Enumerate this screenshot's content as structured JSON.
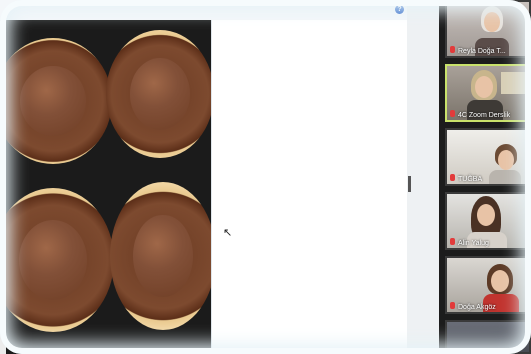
{
  "app": {
    "window": "zoom-meeting-screen-share"
  },
  "share": {
    "help_icon": "?",
    "cursor_icon": "arrow-cursor"
  },
  "participants": [
    {
      "name": "Reyla Doğa T...",
      "active": false
    },
    {
      "name": "4C Zoom Derslik",
      "active": true
    },
    {
      "name": "TUĞBA",
      "active": false
    },
    {
      "name": "Alin Yalug",
      "active": false
    },
    {
      "name": "Doğa Akgöz",
      "active": false
    }
  ],
  "colors": {
    "active_border": "#c9e26b",
    "muted_mic": "#e23b3b"
  }
}
